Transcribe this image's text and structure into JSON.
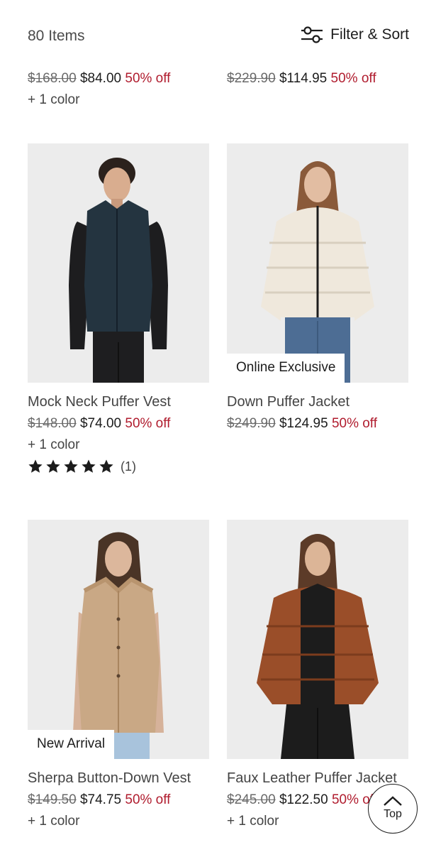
{
  "header": {
    "item_count": "80 Items",
    "filter_label": "Filter & Sort"
  },
  "partial_row": [
    {
      "orig": "$168.00",
      "sale": "$84.00",
      "off": "50% off",
      "colors": "+ 1 color"
    },
    {
      "orig": "$229.90",
      "sale": "$114.95",
      "off": "50% off"
    }
  ],
  "products": [
    {
      "name": "Mock Neck Puffer Vest",
      "orig": "$148.00",
      "sale": "$74.00",
      "off": "50% off",
      "colors": "+ 1 color",
      "rating_count": "(1)",
      "stars": 5
    },
    {
      "name": "Down Puffer Jacket",
      "orig": "$249.90",
      "sale": "$124.95",
      "off": "50% off",
      "badge": "Online Exclusive"
    },
    {
      "name": "Sherpa Button-Down Vest",
      "orig": "$149.50",
      "sale": "$74.75",
      "off": "50% off",
      "colors": "+ 1 color",
      "badge": "New Arrival"
    },
    {
      "name": "Faux Leather Puffer Jacket",
      "orig": "$245.00",
      "sale": "$122.50",
      "off": "50% off",
      "colors": "+ 1 color"
    }
  ],
  "back_to_top": "Top",
  "colors": {
    "sale_red": "#b01c2e",
    "image_bg": "#ececec"
  }
}
